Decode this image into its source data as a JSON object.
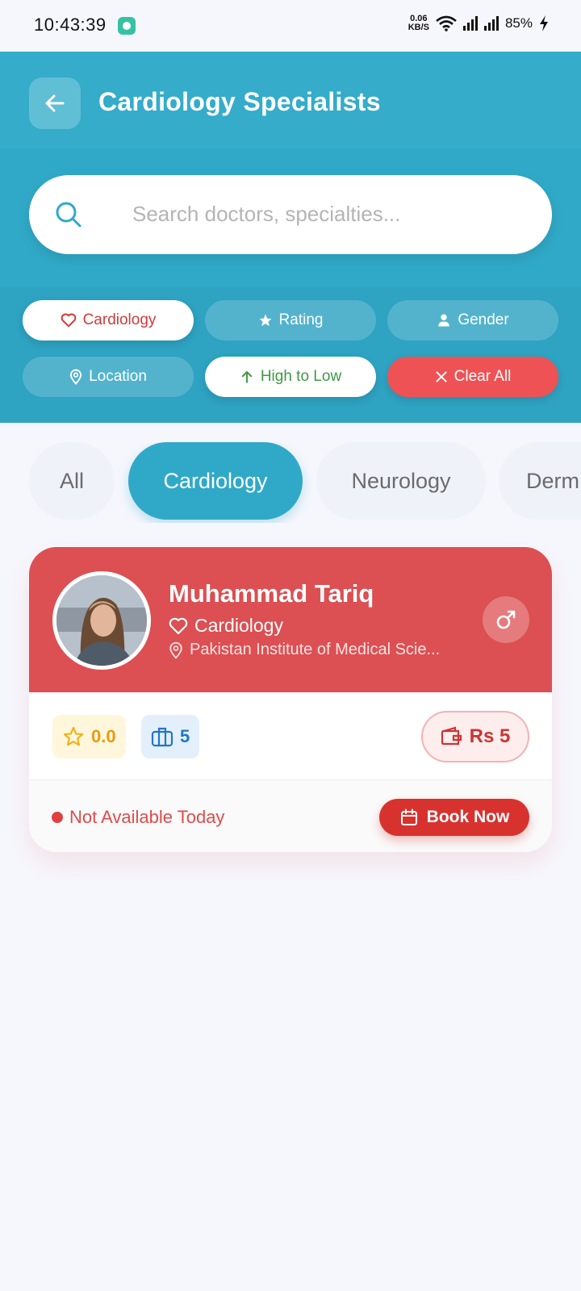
{
  "status_bar": {
    "time": "10:43:39",
    "net_speed": "0.06",
    "net_unit": "KB/S",
    "battery": "85%"
  },
  "header": {
    "title": "Cardiology Specialists",
    "back_icon": "arrow-left-icon"
  },
  "search": {
    "placeholder": "Search doctors, specialties...",
    "value": ""
  },
  "filters": [
    {
      "label": "Cardiology",
      "icon": "heart-icon",
      "state": "selected"
    },
    {
      "label": "Rating",
      "icon": "star-icon",
      "state": "default"
    },
    {
      "label": "Gender",
      "icon": "person-icon",
      "state": "default"
    },
    {
      "label": "Location",
      "icon": "location-pin-icon",
      "state": "default"
    },
    {
      "label": "High to Low",
      "icon": "arrow-up-icon",
      "state": "selected"
    },
    {
      "label": "Clear All",
      "icon": "close-icon",
      "state": "danger"
    }
  ],
  "categories": {
    "items": [
      "All",
      "Cardiology",
      "Neurology",
      "Derm"
    ],
    "active": "Cardiology"
  },
  "doctor": {
    "name": "Muhammad Tariq",
    "specialty": "Cardiology",
    "location": "Pakistan Institute of Medical Scie...",
    "gender_icon": "male-icon",
    "rating": "0.0",
    "experience": "5",
    "fee": "Rs 5",
    "availability": "Not Available Today",
    "book_label": "Book Now"
  },
  "colors": {
    "primary": "#30a9c8",
    "card_header": "#dc4f52",
    "danger": "#ee5255",
    "book_button": "#d8322f",
    "success_text": "#3f9a42"
  }
}
